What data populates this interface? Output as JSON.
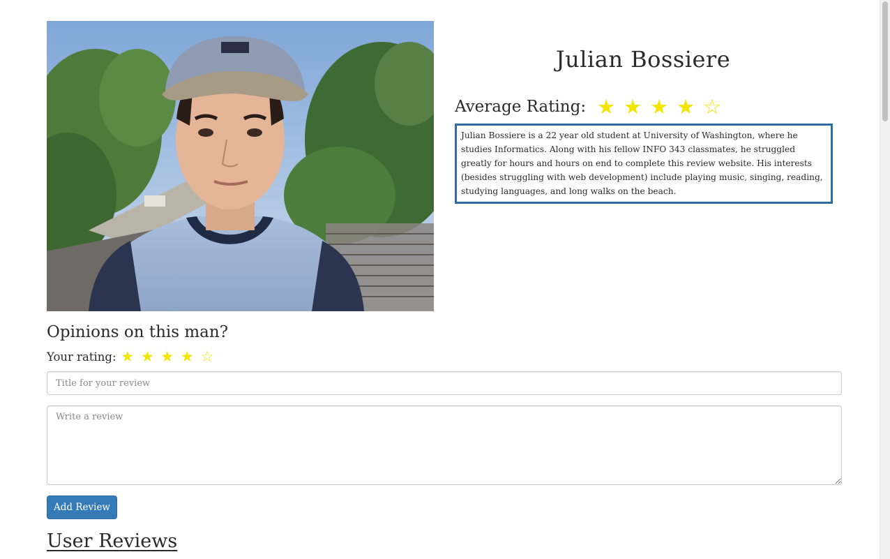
{
  "profile": {
    "name": "Julian Bossiere",
    "average_rating_label": "Average Rating:",
    "average_rating": 4,
    "max_rating": 5,
    "bio": "Julian Bossiere is a 22 year old student at University of Washington, where he studies Informatics. Along with his fellow INFO 343 classmates, he struggled greatly for hours and hours on end to complete this review website. His interests (besides struggling with web development) include playing music, singing, reading, studying languages, and long walks on the beach."
  },
  "review_form": {
    "heading": "Opinions on this man?",
    "your_rating_label": "Your rating:",
    "your_rating": 4,
    "max_rating": 5,
    "title_placeholder": "Title for your review",
    "title_value": "",
    "body_placeholder": "Write a review",
    "body_value": "",
    "submit_label": "Add Review"
  },
  "reviews_section": {
    "heading": "User Reviews"
  },
  "icons": {
    "star_filled": "★",
    "star_empty": "☆"
  },
  "colors": {
    "star": "#f2e600",
    "primary": "#337ab7",
    "bio_border": "#2e6da4"
  }
}
